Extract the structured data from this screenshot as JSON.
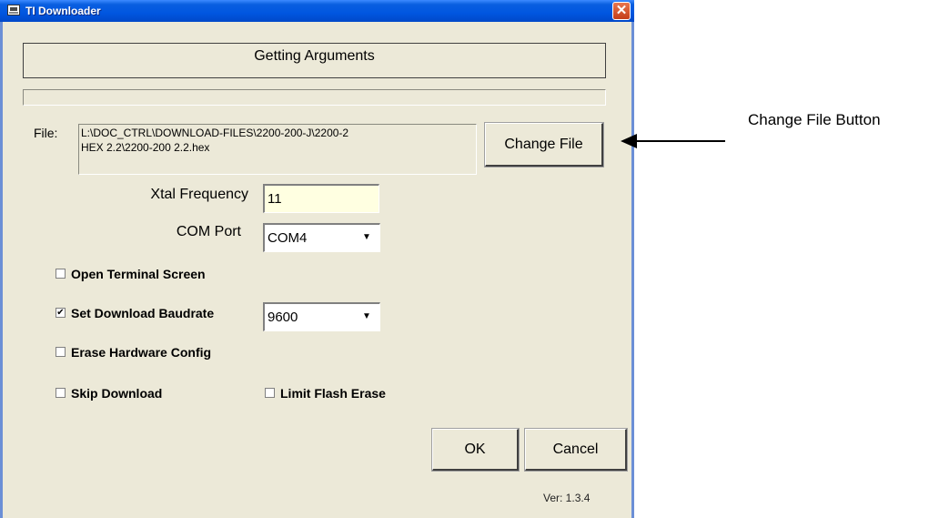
{
  "window": {
    "title": "TI Downloader",
    "close_glyph": "✕",
    "icon": "terminal-app-icon"
  },
  "heading": "Getting Arguments",
  "file": {
    "label": "File:",
    "path_line1": "L:\\DOC_CTRL\\DOWNLOAD-FILES\\2200-200-J\\2200-2",
    "path_line2": "HEX 2.2\\2200-200 2.2.hex"
  },
  "buttons": {
    "change_file": "Change File",
    "ok": "OK",
    "cancel": "Cancel"
  },
  "xtal": {
    "label": "Xtal Frequency",
    "value": "11"
  },
  "com": {
    "label": "COM Port",
    "value": "COM4"
  },
  "options": {
    "open_terminal": {
      "label": "Open Terminal Screen",
      "checked": false
    },
    "set_baudrate": {
      "label": "Set Download Baudrate",
      "checked": true
    },
    "erase_hw_config": {
      "label": "Erase Hardware Config",
      "checked": false
    },
    "skip_download": {
      "label": "Skip Download",
      "checked": false
    },
    "limit_flash_erase": {
      "label": "Limit Flash Erase",
      "checked": false
    }
  },
  "baudrate": {
    "value": "9600"
  },
  "version": "Ver: 1.3.4",
  "annotation": {
    "text": "Change File Button"
  },
  "glyphs": {
    "check": "✔",
    "dropdown": "▼"
  }
}
